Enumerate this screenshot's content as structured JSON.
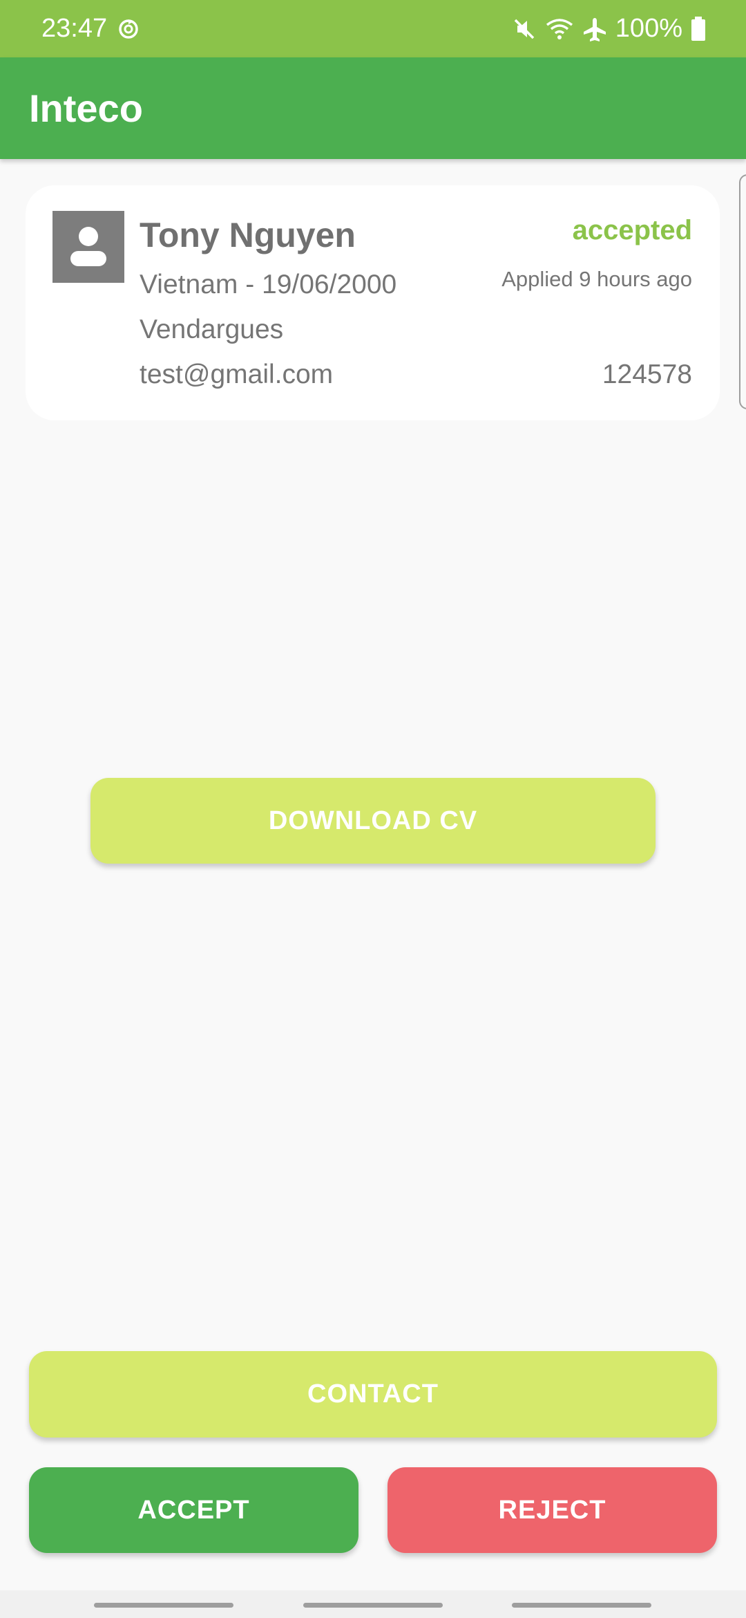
{
  "status_bar": {
    "time": "23:47",
    "battery": "100%",
    "icons": [
      "sync-icon",
      "mute-icon",
      "wifi-icon",
      "airplane-icon",
      "battery-icon"
    ]
  },
  "app_bar": {
    "title": "Inteco"
  },
  "applicant": {
    "name": "Tony Nguyen",
    "country_birth": "Vietnam -  19/06/2000",
    "city": "Vendargues",
    "email": "test@gmail.com",
    "status": "accepted",
    "applied": "Applied 9 hours ago",
    "code": "124578",
    "avatar_icon": "person-icon"
  },
  "buttons": {
    "download_cv": "DOWNLOAD CV",
    "contact": "CONTACT",
    "accept": "ACCEPT",
    "reject": "REJECT"
  },
  "colors": {
    "status_bar": "#8bc34a",
    "app_bar": "#4caf50",
    "accent_lime": "#d6e96c",
    "accept": "#4caf50",
    "reject": "#ee646b",
    "status_accepted": "#8bc34a"
  }
}
